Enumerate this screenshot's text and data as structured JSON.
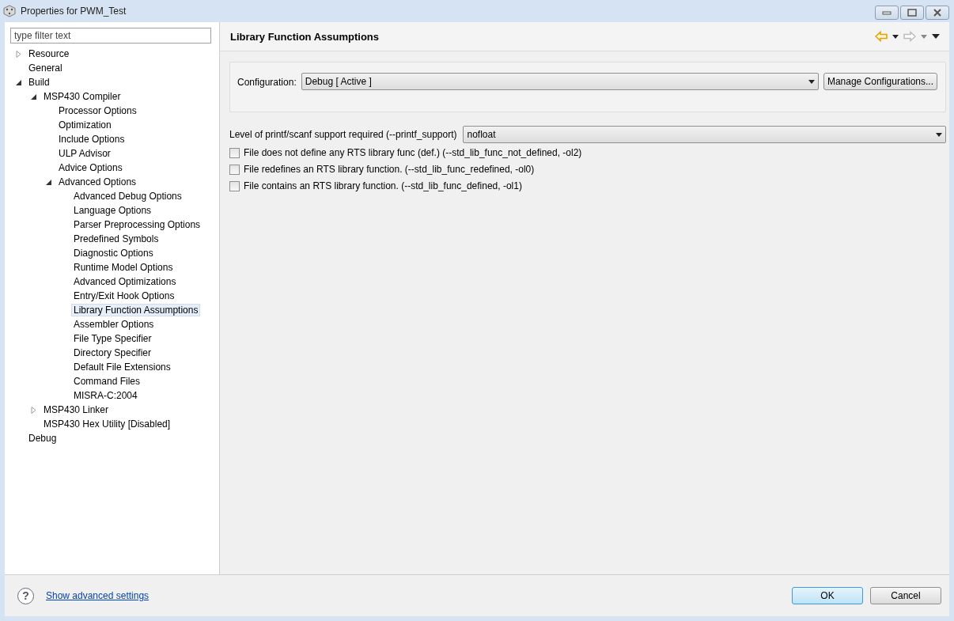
{
  "window": {
    "title": "Properties for PWM_Test"
  },
  "filter": {
    "placeholder": "type filter text"
  },
  "tree": [
    {
      "label": "Resource",
      "expanded": false,
      "selected": false
    },
    {
      "label": "General",
      "selected": false
    },
    {
      "label": "Build",
      "expanded": true,
      "selected": false,
      "children": [
        {
          "label": "MSP430 Compiler",
          "expanded": true,
          "selected": false,
          "children": [
            {
              "label": "Processor Options",
              "selected": false
            },
            {
              "label": "Optimization",
              "selected": false
            },
            {
              "label": "Include Options",
              "selected": false
            },
            {
              "label": "ULP Advisor",
              "selected": false
            },
            {
              "label": "Advice Options",
              "selected": false
            },
            {
              "label": "Advanced Options",
              "expanded": true,
              "selected": false,
              "children": [
                {
                  "label": "Advanced Debug Options",
                  "selected": false
                },
                {
                  "label": "Language Options",
                  "selected": false
                },
                {
                  "label": "Parser Preprocessing Options",
                  "selected": false
                },
                {
                  "label": "Predefined Symbols",
                  "selected": false
                },
                {
                  "label": "Diagnostic Options",
                  "selected": false
                },
                {
                  "label": "Runtime Model Options",
                  "selected": false
                },
                {
                  "label": "Advanced Optimizations",
                  "selected": false
                },
                {
                  "label": "Entry/Exit Hook Options",
                  "selected": false
                },
                {
                  "label": "Library Function Assumptions",
                  "selected": true
                },
                {
                  "label": "Assembler Options",
                  "selected": false
                },
                {
                  "label": "File Type Specifier",
                  "selected": false
                },
                {
                  "label": "Directory Specifier",
                  "selected": false
                },
                {
                  "label": "Default File Extensions",
                  "selected": false
                },
                {
                  "label": "Command Files",
                  "selected": false
                },
                {
                  "label": "MISRA-C:2004",
                  "selected": false
                }
              ]
            }
          ]
        },
        {
          "label": "MSP430 Linker",
          "expanded": false,
          "selected": false
        },
        {
          "label": "MSP430 Hex Utility  [Disabled]",
          "selected": false
        }
      ]
    },
    {
      "label": "Debug",
      "selected": false
    }
  ],
  "page": {
    "title": "Library Function Assumptions"
  },
  "configuration": {
    "label": "Configuration:",
    "value": "Debug  [ Active ]",
    "button": "Manage Configurations..."
  },
  "printf_support": {
    "label": "Level of printf/scanf support required (--printf_support)",
    "value": "nofloat"
  },
  "options": [
    {
      "label": "File does not define any RTS library func (def.) (--std_lib_func_not_defined, -ol2)",
      "checked": false
    },
    {
      "label": "File redefines an RTS library function. (--std_lib_func_redefined, -ol0)",
      "checked": false
    },
    {
      "label": "File contains an RTS library function. (--std_lib_func_defined, -ol1)",
      "checked": false
    }
  ],
  "footer": {
    "help": "?",
    "link": "Show advanced settings",
    "buttons": [
      {
        "label": "OK",
        "kind": "default"
      },
      {
        "label": "Cancel",
        "kind": "normal"
      }
    ]
  }
}
